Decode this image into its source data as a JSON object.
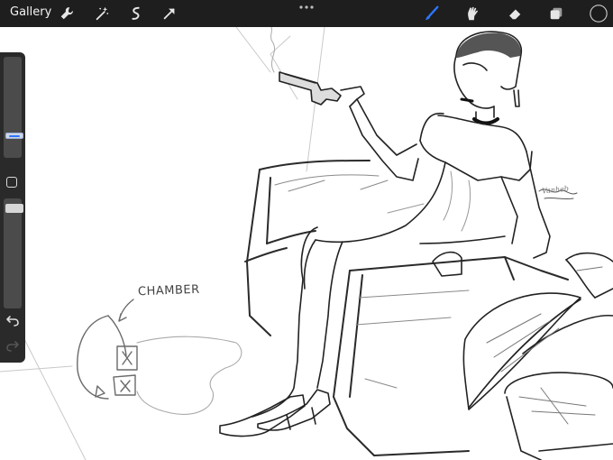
{
  "toolbar": {
    "gallery_label": "Gallery",
    "left_icons": [
      "wrench-icon",
      "magic-wand-icon",
      "selection-icon",
      "transform-arrow-icon"
    ],
    "more_icon": "more-dots-icon",
    "right_icons": [
      "brush-icon",
      "smudge-icon",
      "eraser-icon",
      "layers-icon",
      "color-swatch-icon"
    ],
    "active_tool": "brush",
    "colors": {
      "bar": "#1e1e1e",
      "active_tool": "#2b76ff",
      "current_color": "#1b1b1b"
    }
  },
  "sidebar": {
    "brush_size_level": 0.2,
    "opacity_level": 0.95,
    "buttons": [
      "modify-button",
      "undo-button",
      "redo-button"
    ],
    "redo_enabled": false
  },
  "canvas": {
    "annotation_label": "CHAMBER",
    "signature_text": "Vanheb"
  }
}
